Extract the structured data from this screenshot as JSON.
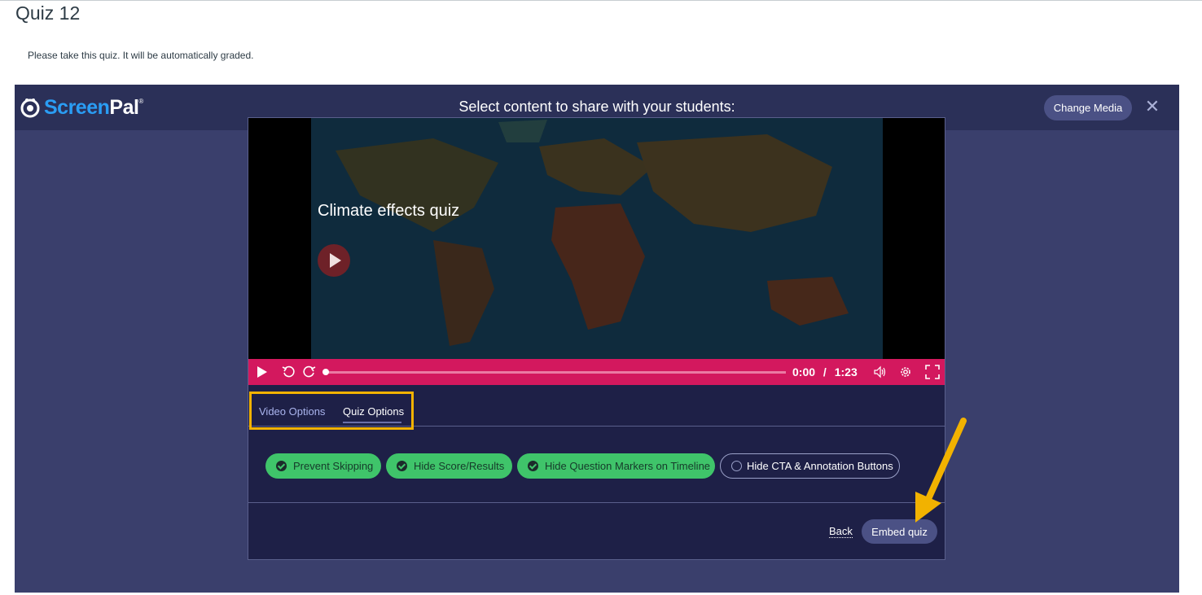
{
  "page": {
    "title": "Quiz 12",
    "intro": "Please take this quiz. It will be automatically graded."
  },
  "modal": {
    "brand": "ScreenPal",
    "heading": "Select content to share with your students:",
    "change_media_label": "Change Media",
    "close_icon": "close-icon"
  },
  "video": {
    "title": "Climate effects quiz",
    "current_time": "0:00",
    "time_separator": "/",
    "duration": "1:23",
    "progress_fraction": 0.0
  },
  "tabs": [
    {
      "label": "Video Options",
      "active": false
    },
    {
      "label": "Quiz Options",
      "active": true
    }
  ],
  "quiz_options": [
    {
      "label": "Prevent Skipping",
      "checked": true
    },
    {
      "label": "Hide Score/Results",
      "checked": true
    },
    {
      "label": "Hide Question Markers on Timeline",
      "checked": true
    },
    {
      "label": "Hide CTA & Annotation Buttons",
      "checked": false
    }
  ],
  "footer": {
    "back_label": "Back",
    "embed_label": "Embed quiz"
  },
  "colors": {
    "header": "#2b3058",
    "panel": "#1e2047",
    "player_bar": "#d3185e",
    "option_on": "#3fc46a",
    "highlight": "#f2b200"
  }
}
